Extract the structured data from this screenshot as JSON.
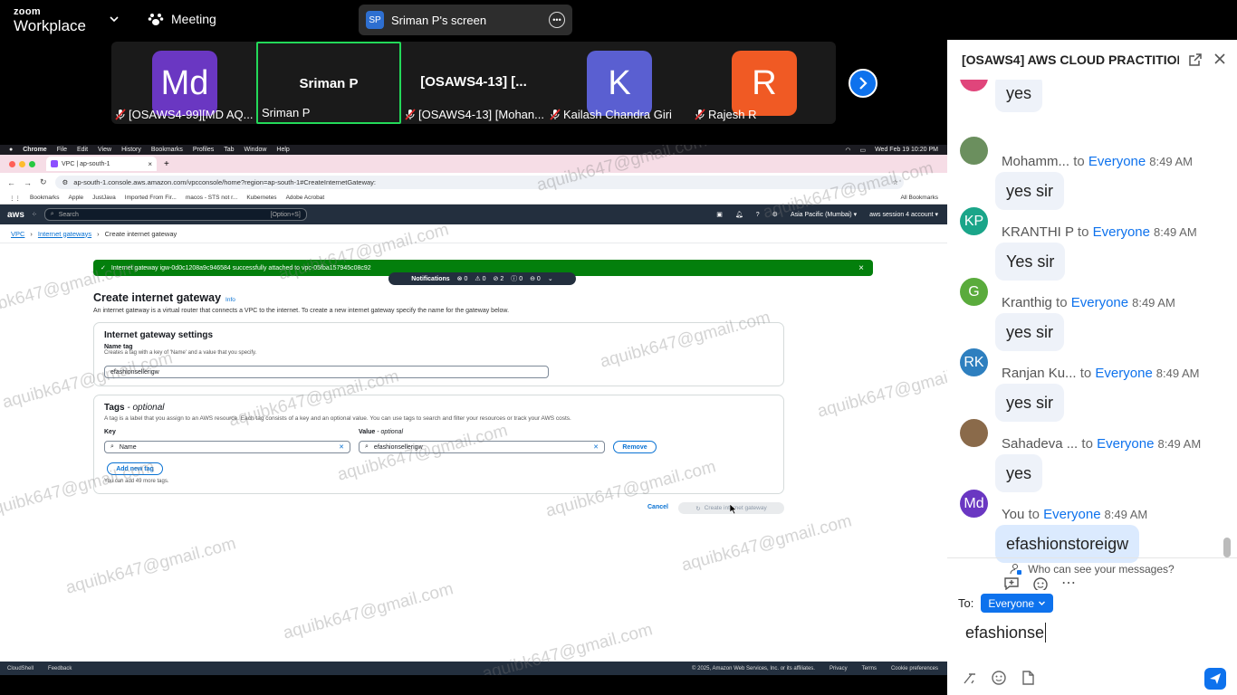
{
  "zoom": {
    "brand_top": "zoom",
    "brand_bottom": "Workplace",
    "meeting_label": "Meeting",
    "share_initials": "SP",
    "share_label": "Sriman P's screen"
  },
  "participants": [
    {
      "kind": "avatar",
      "initials": "Md",
      "color": "#6a37c2",
      "name": "[OSAWS4-99][MD AQ...",
      "muted": true
    },
    {
      "kind": "text",
      "big": "Sriman P",
      "name": "Sriman P",
      "muted": false
    },
    {
      "kind": "text",
      "big": "[OSAWS4-13] [...",
      "name": "[OSAWS4-13] [Mohan...",
      "muted": true
    },
    {
      "kind": "avatar",
      "initials": "K",
      "color": "#5a5fd1",
      "name": "Kailash Chandra Giri",
      "muted": true
    },
    {
      "kind": "avatar",
      "initials": "R",
      "color": "#f05a24",
      "name": "Rajesh R",
      "muted": true
    }
  ],
  "mac": {
    "app": "Chrome",
    "menus": [
      "File",
      "Edit",
      "View",
      "History",
      "Bookmarks",
      "Profiles",
      "Tab",
      "Window",
      "Help"
    ],
    "clock": "Wed Feb 19  10:20 PM"
  },
  "browser": {
    "tab_title": "VPC | ap-south-1",
    "url": "ap-south-1.console.aws.amazon.com/vpcconsole/home?region=ap-south-1#CreateInternetGateway:",
    "profile": "S"
  },
  "bookmarks": {
    "items": [
      "Bookmarks",
      "Apple",
      "JustJava",
      "Imported From Fir...",
      "macos - STS not r...",
      "Kubernetes",
      "Adobe Acrobat"
    ],
    "all": "All Bookmarks"
  },
  "aws": {
    "logo": "aws",
    "search_placeholder": "Search",
    "search_shortcut": "[Option+S]",
    "region": "Asia Pacific (Mumbai) ▾",
    "account": "aws session 4 account ▾"
  },
  "breadcrumb": [
    "VPC",
    "Internet gateways",
    "Create internet gateway"
  ],
  "flash": {
    "message": "Internet gateway igw-0d0c1208a9c946584 successfully attached to vpc-05fba157945c08c92"
  },
  "notifications": {
    "label": "Notifications",
    "counts": [
      "0",
      "0",
      "2",
      "0",
      "0"
    ]
  },
  "page": {
    "title": "Create internet gateway",
    "info": "Info",
    "description": "An internet gateway is a virtual router that connects a VPC to the internet. To create a new internet gateway specify the name for the gateway below."
  },
  "settings": {
    "heading": "Internet gateway settings",
    "name_label": "Name tag",
    "name_hint": "Creates a tag with a key of 'Name' and a value that you specify.",
    "name_value": "efashionsellerigw"
  },
  "tags": {
    "heading": "Tags",
    "heading_optional": " - optional",
    "desc": "A tag is a label that you assign to an AWS resource. Each tag consists of a key and an optional value. You can use tags to search and filter your resources or track your AWS costs.",
    "key_label": "Key",
    "value_label": "Value",
    "value_optional": " - optional",
    "key_value": "Name",
    "value_value": "efashionsellerigw",
    "remove": "Remove",
    "add": "Add new tag",
    "limit": "You can add 49 more tags."
  },
  "actions": {
    "cancel": "Cancel",
    "create": "Create internet gateway"
  },
  "footer": {
    "cloudshell": "CloudShell",
    "feedback": "Feedback",
    "copyright": "© 2025, Amazon Web Services, Inc. or its affiliates.",
    "privacy": "Privacy",
    "terms": "Terms",
    "cookies": "Cookie preferences"
  },
  "watermark": "aquibk647@gmail.com",
  "chat": {
    "title": "[OSAWS4] AWS CLOUD PRACTITION...",
    "to_word": "to",
    "messages": [
      {
        "sender": "",
        "to": "",
        "time": "",
        "text": "yes",
        "initials": "",
        "color": "#e0457b",
        "me": false
      },
      {
        "sender": "Mohamm...",
        "to": "Everyone",
        "time": "8:49 AM",
        "text": "yes sir",
        "initials": "",
        "color": "#6b8f5e",
        "me": false
      },
      {
        "sender": "KRANTHI P",
        "to": "Everyone",
        "time": "8:49 AM",
        "text": "Yes sir",
        "initials": "KP",
        "color": "#1aa589",
        "me": false
      },
      {
        "sender": "Kranthig",
        "to": "Everyone",
        "time": "8:49 AM",
        "text": "yes sir",
        "initials": "G",
        "color": "#5aab3c",
        "me": false
      },
      {
        "sender": "Ranjan Ku...",
        "to": "Everyone",
        "time": "8:49 AM",
        "text": "yes sir",
        "initials": "RK",
        "color": "#2e7fbf",
        "me": false
      },
      {
        "sender": "Sahadeva ...",
        "to": "Everyone",
        "time": "8:49 AM",
        "text": "yes",
        "initials": "",
        "color": "#8a6a4a",
        "me": false
      },
      {
        "sender": "You",
        "to": "Everyone",
        "time": "8:49 AM",
        "text": "efashionstoreigw",
        "initials": "Md",
        "color": "#6a37c2",
        "me": true
      }
    ],
    "who_can_see": "Who can see your messages?",
    "to_label": "To:",
    "recipient": "Everyone",
    "draft": "efashionse"
  }
}
